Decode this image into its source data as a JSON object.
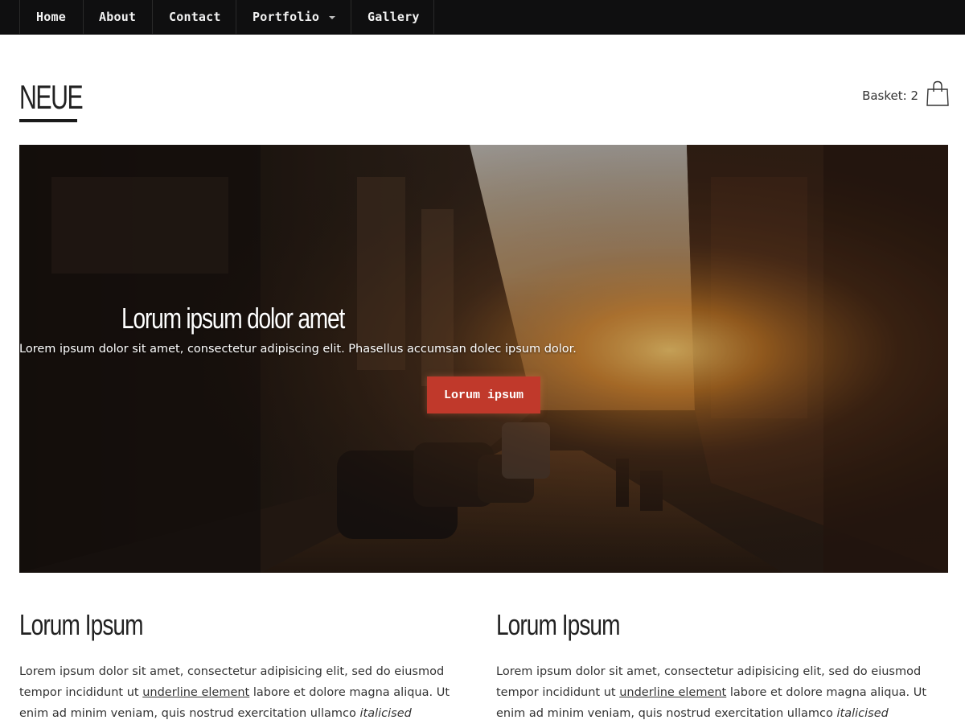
{
  "nav": {
    "items": [
      {
        "label": "Home"
      },
      {
        "label": "About"
      },
      {
        "label": "Contact"
      },
      {
        "label": "Portfolio"
      },
      {
        "label": "Gallery"
      }
    ]
  },
  "header": {
    "logo": "NEUE",
    "basket_label": "Basket: 2"
  },
  "hero": {
    "title": "Lorum ipsum dolor amet",
    "subtitle": "Lorem ipsum dolor sit amet, consectetur adipiscing elit. Phasellus accumsan dolec ipsum dolor.",
    "button_label": "Lorum ipsum"
  },
  "columns": [
    {
      "heading": "Lorum Ipsum",
      "text_1": "Lorem ipsum dolor sit amet, consectetur adipisicing elit, sed do eiusmod tempor incididunt ut ",
      "link": "underline element",
      "text_2": " labore et dolore magna aliqua. Ut enim ad minim veniam, quis nostrud exercitation ullamco ",
      "italic": "italicised"
    },
    {
      "heading": "Lorum Ipsum",
      "text_1": "Lorem ipsum dolor sit amet, consectetur adipisicing elit, sed do eiusmod tempor incididunt ut ",
      "link": "underline element",
      "text_2": " labore et dolore magna aliqua. Ut enim ad minim veniam, quis nostrud exercitation ullamco ",
      "italic": "italicised"
    }
  ],
  "colors": {
    "nav_bg": "#0f0f10",
    "accent_button": "#c0392b"
  }
}
